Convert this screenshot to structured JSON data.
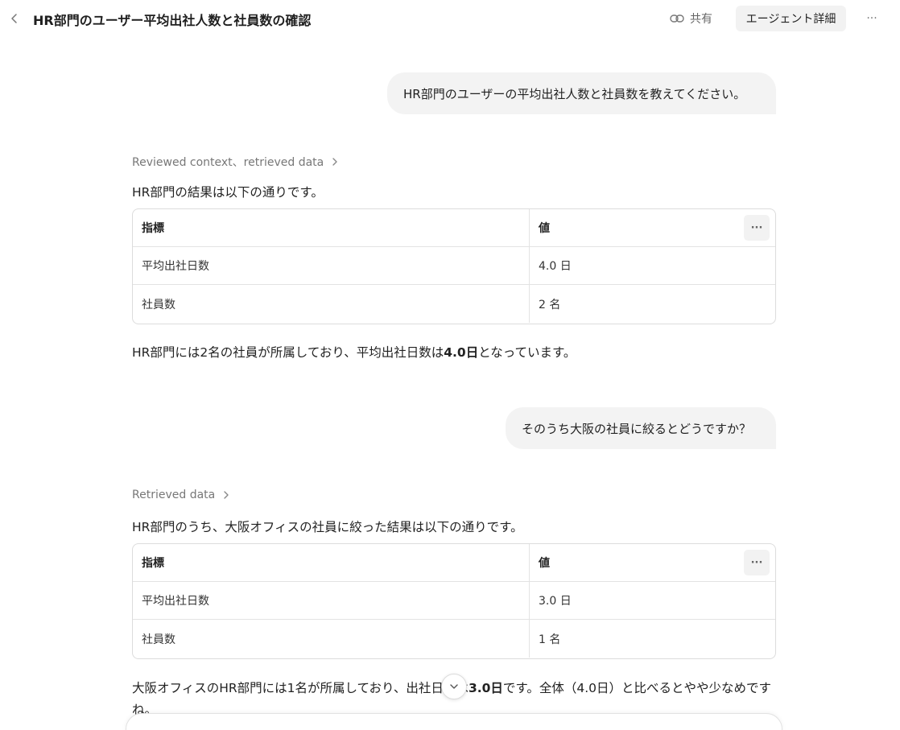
{
  "header": {
    "title": "HR部門のユーザー平均出社人数と社員数の確認",
    "share_label": "共有",
    "agent_details_label": "エージェント詳細",
    "more_label": "···"
  },
  "conversation": {
    "turn1": {
      "user_message": "HR部門のユーザーの平均出社人数と社員数を教えてください。",
      "context_label": "Reviewed context、retrieved data",
      "intro": "HR部門の結果は以下の通りです。",
      "table": {
        "headers": [
          "指標",
          "値"
        ],
        "rows": [
          [
            "平均出社日数",
            "4.0 日"
          ],
          [
            "社員数",
            "2 名"
          ]
        ]
      },
      "summary": {
        "before": "HR部門には2名の社員が所属しており、平均出社日数は",
        "bold": "4.0日",
        "after": "となっています。"
      }
    },
    "turn2": {
      "user_message": "そのうち大阪の社員に絞るとどうですか？",
      "context_label": "Retrieved data",
      "intro": "HR部門のうち、大阪オフィスの社員に絞った結果は以下の通りです。",
      "table": {
        "headers": [
          "指標",
          "値"
        ],
        "rows": [
          [
            "平均出社日数",
            "3.0 日"
          ],
          [
            "社員数",
            "1 名"
          ]
        ]
      },
      "summary": {
        "before": "大阪オフィスのHR部門には1名が所属しており、出社日数は",
        "bold": "3.0日",
        "after": "です。全体（4.0日）と比べるとやや少なめですね。"
      }
    }
  },
  "icons": {
    "back": "chevron-left-icon",
    "share": "link-icon",
    "context_expand": "chevron-right-icon",
    "scroll_down": "chevron-down-icon"
  },
  "table_more_label": "···"
}
